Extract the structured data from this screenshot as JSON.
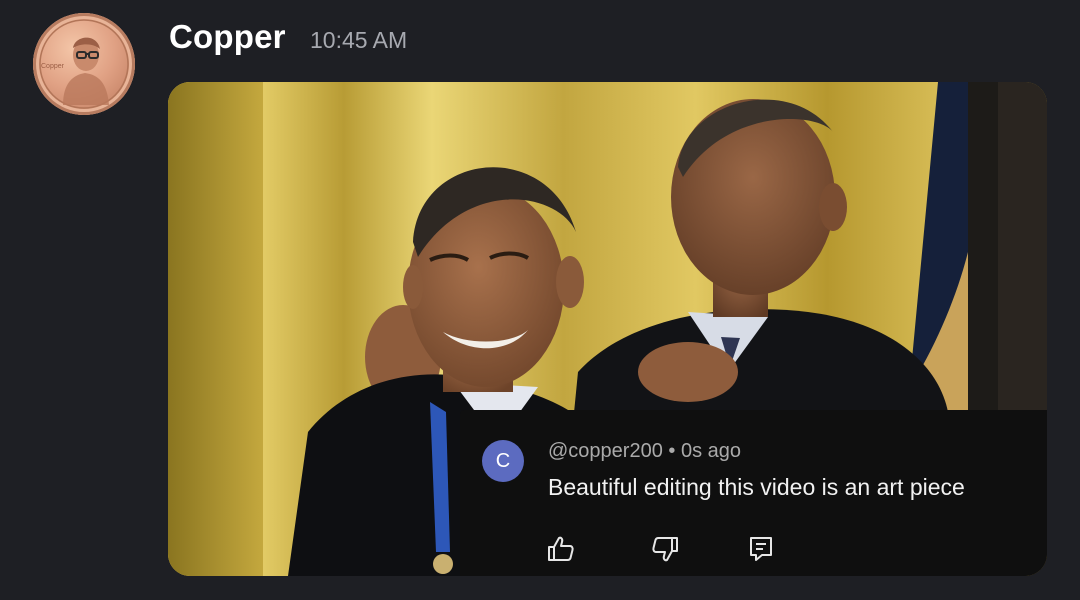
{
  "message": {
    "author": "Copper",
    "time": "10:45 AM",
    "avatar_icon": "penny-coin-icon"
  },
  "comment_overlay": {
    "avatar_letter": "C",
    "handle": "@copper200",
    "separator": "•",
    "age": "0s ago",
    "text": "Beautiful editing this video is an art piece",
    "actions": [
      "thumbs-up-icon",
      "thumbs-down-icon",
      "reply-icon"
    ],
    "colors": {
      "avatar_bg": "#5c6bc0",
      "panel_bg": "#0f0f0f"
    }
  },
  "theme": {
    "background": "#1e1f24",
    "username": "#ffffff",
    "timestamp": "#a7a9b0"
  }
}
